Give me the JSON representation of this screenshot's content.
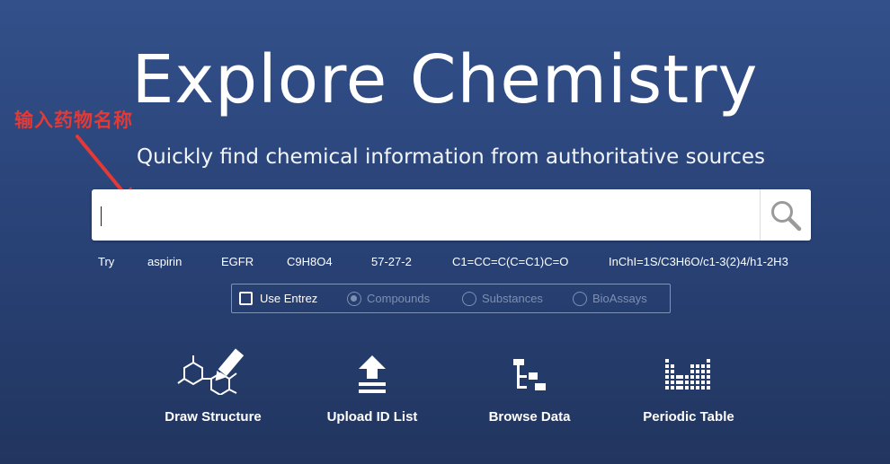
{
  "hero": {
    "title": "Explore Chemistry",
    "subtitle": "Quickly find chemical information from authoritative sources"
  },
  "annotation": {
    "text": "输入药物名称",
    "color": "#e53935"
  },
  "search": {
    "value": "",
    "placeholder": "",
    "button_icon": "search-icon"
  },
  "examples": {
    "prefix": "Try",
    "items": [
      "aspirin",
      "EGFR",
      "C9H8O4",
      "57-27-2",
      "C1=CC=C(C=C1)C=O",
      "InChI=1S/C3H6O/c1-3(2)4/h1-2H3"
    ]
  },
  "options": {
    "use_entrez": {
      "label": "Use Entrez",
      "checked": false
    },
    "radios": [
      {
        "label": "Compounds",
        "selected": true
      },
      {
        "label": "Substances",
        "selected": false
      },
      {
        "label": "BioAssays",
        "selected": false
      }
    ]
  },
  "tools": [
    {
      "label": "Draw Structure",
      "icon": "draw-structure-icon"
    },
    {
      "label": "Upload ID List",
      "icon": "upload-icon"
    },
    {
      "label": "Browse Data",
      "icon": "browse-tree-icon"
    },
    {
      "label": "Periodic Table",
      "icon": "periodic-table-icon"
    }
  ],
  "colors": {
    "background_top": "#33508a",
    "background_bottom": "#21355f",
    "disabled_text": "#7d8fb2"
  }
}
